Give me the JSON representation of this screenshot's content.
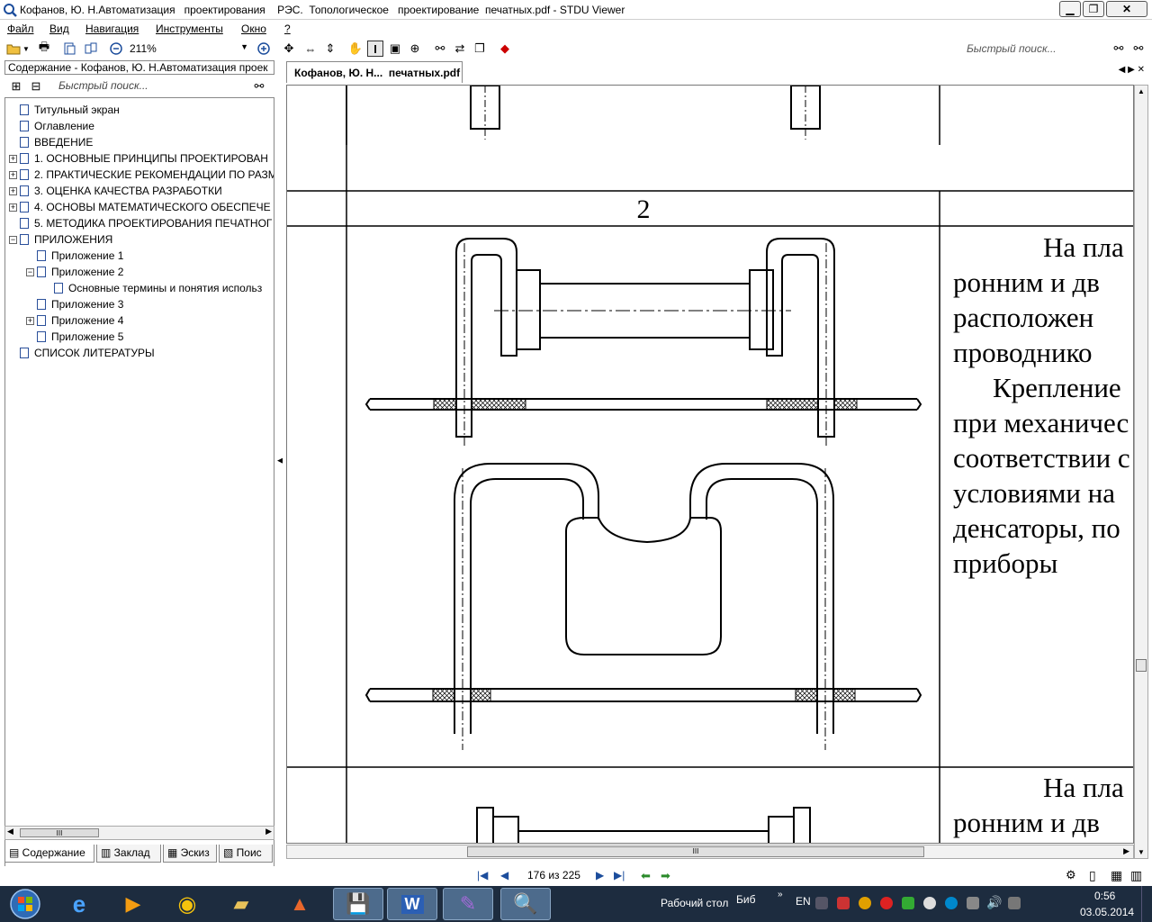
{
  "window": {
    "title": "Кофанов, Ю. Н.Автоматизация   проектирования    РЭС.  Топологическое   проектирование  печатных.pdf - STDU Viewer"
  },
  "menu": [
    "Файл",
    "Вид",
    "Навигация",
    "Инструменты",
    "Окно",
    "?"
  ],
  "toolbar": {
    "zoom": "211%",
    "quick_search_placeholder": "Быстрый поиск..."
  },
  "left_panel": {
    "doc_title": "Содержание - Кофанов, Ю. Н.Автоматизация   проек",
    "search_placeholder": "Быстрый поиск...",
    "tree": [
      {
        "label": "Титульный экран",
        "level": 0,
        "expander": ""
      },
      {
        "label": "Оглавление",
        "level": 0,
        "expander": ""
      },
      {
        "label": "ВВЕДЕНИЕ",
        "level": 0,
        "expander": ""
      },
      {
        "label": "1. ОСНОВНЫЕ  ПРИНЦИПЫ  ПРОЕКТИРОВАН",
        "level": 0,
        "expander": "+"
      },
      {
        "label": "2. ПРАКТИЧЕСКИЕ РЕКОМЕНДАЦИИ ПО РАЗМ",
        "level": 0,
        "expander": "+"
      },
      {
        "label": "3. ОЦЕНКА КАЧЕСТВА РАЗРАБОТКИ",
        "level": 0,
        "expander": "+"
      },
      {
        "label": "4. ОСНОВЫ  МАТЕМАТИЧЕСКОГО  ОБЕСПЕЧЕ",
        "level": 0,
        "expander": "+"
      },
      {
        "label": "5. МЕТОДИКА ПРОЕКТИРОВАНИЯ ПЕЧАТНОГ",
        "level": 0,
        "expander": ""
      },
      {
        "label": "ПРИЛОЖЕНИЯ",
        "level": 0,
        "expander": "−"
      },
      {
        "label": "Приложение 1",
        "level": 1,
        "expander": ""
      },
      {
        "label": "Приложение 2",
        "level": 1,
        "expander": "−"
      },
      {
        "label": "Основные термины и понятия использ",
        "level": 2,
        "expander": ""
      },
      {
        "label": "Приложение 3",
        "level": 1,
        "expander": ""
      },
      {
        "label": "Приложение 4",
        "level": 1,
        "expander": "+"
      },
      {
        "label": "Приложение 5",
        "level": 1,
        "expander": ""
      },
      {
        "label": "СПИСОК  ЛИТЕРАТУРЫ",
        "level": 0,
        "expander": ""
      }
    ],
    "tabs": [
      "Содержание",
      "Заклад",
      "Эскиз",
      "Поис"
    ]
  },
  "document": {
    "tab_title": "Кофанов, Ю. Н...  печатных.pdf",
    "row_number": "2",
    "text_lines_a": [
      "На пла",
      "ронним и дв",
      "расположен",
      "проводнико",
      "Крепление",
      "при механичес",
      "соответствии с",
      "условиями на",
      "денсаторы, по",
      "приборы"
    ],
    "text_lines_b": [
      "На пла",
      "ронним и дв"
    ]
  },
  "status": {
    "page_indicator": "176 из 225"
  },
  "taskbar": {
    "desktop_label": "Рабочий стол",
    "lib_label": "Биб",
    "lang": "EN",
    "time": "0:56",
    "date": "03.05.2014"
  },
  "colors": {
    "taskbar_bg": "#1d2c3f",
    "tree_icon_border": "#2a4f9a"
  }
}
